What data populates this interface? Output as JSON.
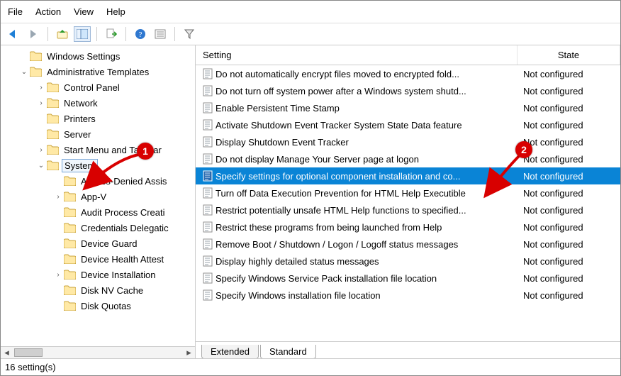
{
  "menu": {
    "file": "File",
    "action": "Action",
    "view": "View",
    "help": "Help"
  },
  "toolbar": {
    "back": "back-arrow-icon",
    "forward": "forward-arrow-icon",
    "up": "up-folder-icon",
    "show": "show-pane-icon",
    "export": "export-list-icon",
    "help": "help-icon",
    "props": "properties-icon",
    "filter": "filter-icon"
  },
  "tree": [
    {
      "depth": 0,
      "expander": "",
      "label": "Windows Settings"
    },
    {
      "depth": 0,
      "expander": "v",
      "label": "Administrative Templates"
    },
    {
      "depth": 1,
      "expander": ">",
      "label": "Control Panel"
    },
    {
      "depth": 1,
      "expander": ">",
      "label": "Network"
    },
    {
      "depth": 1,
      "expander": "",
      "label": "Printers"
    },
    {
      "depth": 1,
      "expander": "",
      "label": "Server"
    },
    {
      "depth": 1,
      "expander": ">",
      "label": "Start Menu and Taskbar"
    },
    {
      "depth": 1,
      "expander": "v",
      "label": "System",
      "selected": true
    },
    {
      "depth": 2,
      "expander": "",
      "label": "Access-Denied Assis"
    },
    {
      "depth": 2,
      "expander": ">",
      "label": "App-V"
    },
    {
      "depth": 2,
      "expander": "",
      "label": "Audit Process Creati"
    },
    {
      "depth": 2,
      "expander": "",
      "label": "Credentials Delegatic"
    },
    {
      "depth": 2,
      "expander": "",
      "label": "Device Guard"
    },
    {
      "depth": 2,
      "expander": "",
      "label": "Device Health Attest"
    },
    {
      "depth": 2,
      "expander": ">",
      "label": "Device Installation"
    },
    {
      "depth": 2,
      "expander": "",
      "label": "Disk NV Cache"
    },
    {
      "depth": 2,
      "expander": "",
      "label": "Disk Quotas"
    }
  ],
  "columns": {
    "setting": "Setting",
    "state": "State"
  },
  "settings": [
    {
      "name": "Do not automatically encrypt files moved to encrypted fold...",
      "state": "Not configured"
    },
    {
      "name": "Do not turn off system power after a Windows system shutd...",
      "state": "Not configured"
    },
    {
      "name": "Enable Persistent Time Stamp",
      "state": "Not configured"
    },
    {
      "name": "Activate Shutdown Event Tracker System State Data feature",
      "state": "Not configured"
    },
    {
      "name": "Display Shutdown Event Tracker",
      "state": "Not configured"
    },
    {
      "name": "Do not display Manage Your Server page at logon",
      "state": "Not configured"
    },
    {
      "name": "Specify settings for optional component installation and co...",
      "state": "Not configured",
      "selected": true
    },
    {
      "name": "Turn off Data Execution Prevention for HTML Help Executible",
      "state": "Not configured"
    },
    {
      "name": "Restrict potentially unsafe HTML Help functions to specified...",
      "state": "Not configured"
    },
    {
      "name": "Restrict these programs from being launched from Help",
      "state": "Not configured"
    },
    {
      "name": "Remove Boot / Shutdown / Logon / Logoff status messages",
      "state": "Not configured"
    },
    {
      "name": "Display highly detailed status messages",
      "state": "Not configured"
    },
    {
      "name": "Specify Windows Service Pack installation file location",
      "state": "Not configured"
    },
    {
      "name": "Specify Windows installation file location",
      "state": "Not configured"
    }
  ],
  "tabs": {
    "extended": "Extended",
    "standard": "Standard"
  },
  "status": "16 setting(s)",
  "callouts": {
    "one": "1",
    "two": "2"
  }
}
